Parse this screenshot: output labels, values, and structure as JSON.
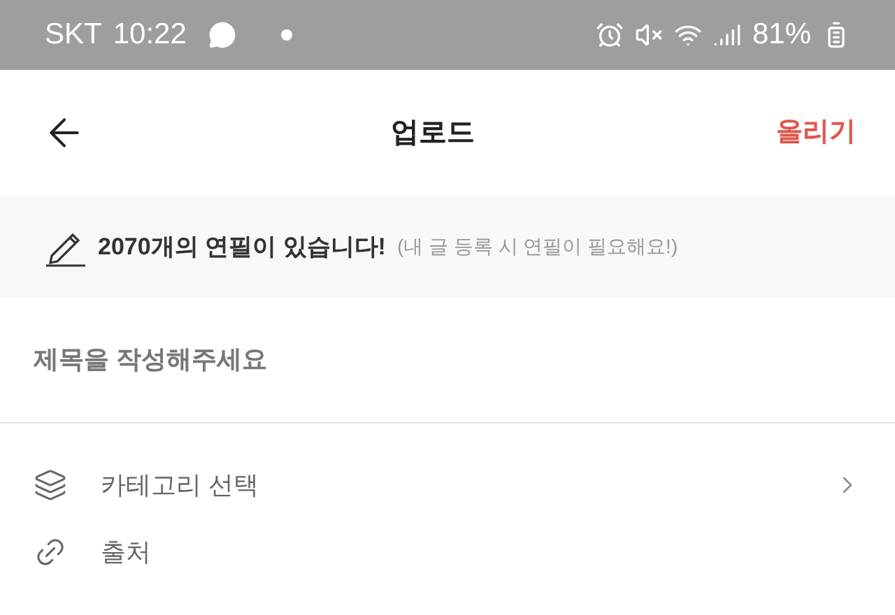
{
  "status_bar": {
    "carrier": "SKT",
    "time": "10:22",
    "battery": "81%"
  },
  "header": {
    "title": "업로드",
    "action": "올리기"
  },
  "pencil_notice": {
    "count_text": "2070개의 연필이 있습니다!",
    "hint": "(내 글 등록 시 연필이 필요해요!)"
  },
  "title_field": {
    "placeholder": "제목을 작성해주세요"
  },
  "menu_items": [
    {
      "kind": "category",
      "label": "카테고리 선택",
      "has_chevron": true
    },
    {
      "kind": "source",
      "label": "출처",
      "has_chevron": false
    }
  ]
}
